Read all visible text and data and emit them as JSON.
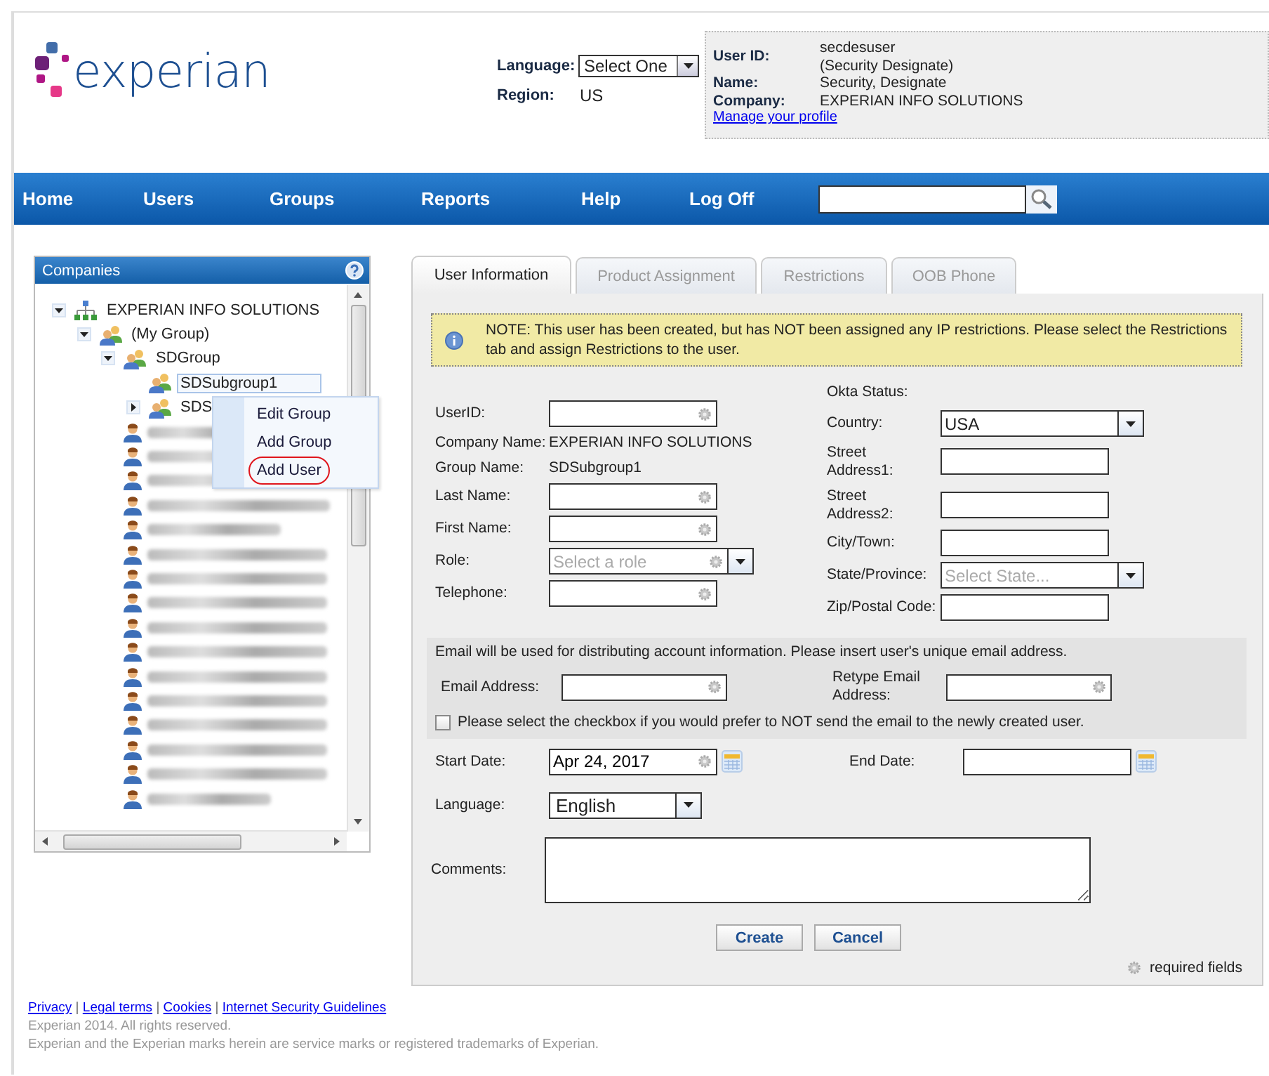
{
  "header": {
    "logo_text": "experian",
    "language": {
      "label": "Language:",
      "value": "Select One"
    },
    "region": {
      "label": "Region:",
      "value": "US"
    },
    "profile": {
      "fields": [
        {
          "label": "User ID:",
          "value": "secdesuser",
          "note": "(Security Designate)"
        },
        {
          "label": "Name:",
          "value": "Security, Designate"
        },
        {
          "label": "Company:",
          "value": "EXPERIAN INFO SOLUTIONS"
        }
      ],
      "link": "Manage your profile"
    }
  },
  "nav": {
    "items": [
      "Home",
      "Users",
      "Groups",
      "Reports",
      "Help",
      "Log Off"
    ]
  },
  "companies_panel": {
    "title": "Companies",
    "tree": [
      {
        "kind": "company",
        "label": "EXPERIAN INFO SOLUTIONS",
        "expanded": true,
        "selected": false,
        "children": [
          {
            "kind": "group",
            "label": "(My Group)",
            "expanded": true,
            "selected": false,
            "children": [
              {
                "kind": "group",
                "label": "SDGroup",
                "expanded": true,
                "selected": false,
                "children": [
                  {
                    "kind": "group",
                    "label": "SDSubgroup1",
                    "selected": true
                  },
                  {
                    "kind": "group",
                    "label": "SDS",
                    "expanded": false,
                    "selected": false
                  }
                ]
              },
              {
                "kind": "user_blurred"
              },
              {
                "kind": "user_blurred"
              },
              {
                "kind": "user_blurred"
              },
              {
                "kind": "user_blurred"
              },
              {
                "kind": "user_blurred"
              },
              {
                "kind": "user_blurred"
              },
              {
                "kind": "user_blurred"
              },
              {
                "kind": "user_blurred"
              },
              {
                "kind": "user_blurred"
              },
              {
                "kind": "user_blurred"
              },
              {
                "kind": "user_blurred"
              },
              {
                "kind": "user_blurred"
              },
              {
                "kind": "user_blurred"
              },
              {
                "kind": "user_blurred"
              },
              {
                "kind": "user_blurred"
              },
              {
                "kind": "user_blurred"
              }
            ]
          }
        ]
      }
    ]
  },
  "context_menu": {
    "items": [
      {
        "label": "Edit Group",
        "circled": false
      },
      {
        "label": "Add Group",
        "circled": false
      },
      {
        "label": "Add User",
        "circled": true
      }
    ]
  },
  "tabs": [
    {
      "label": "User Information",
      "selected": true
    },
    {
      "label": "Product Assignment",
      "selected": false
    },
    {
      "label": "Restrictions",
      "selected": false
    },
    {
      "label": "OOB Phone",
      "selected": false
    }
  ],
  "note": "NOTE: This user has been created, but has NOT been assigned any IP restrictions. Please select the Restrictions tab and assign Restrictions to the user.",
  "left_fields": [
    {
      "kind": "input",
      "label": "UserID:",
      "required": true
    },
    {
      "kind": "text",
      "label": "Company Name:",
      "value": "EXPERIAN INFO SOLUTIONS"
    },
    {
      "kind": "text",
      "label": "Group Name:",
      "value": "SDSubgroup1"
    },
    {
      "kind": "input",
      "label": "Last Name:",
      "required": true
    },
    {
      "kind": "input",
      "label": "First Name:",
      "required": true
    },
    {
      "kind": "select",
      "label": "Role:",
      "placeholder": "Select a role",
      "required": true
    },
    {
      "kind": "input",
      "label": "Telephone:",
      "required": true
    }
  ],
  "right_fields": [
    {
      "kind": "label",
      "label": "Okta Status:"
    },
    {
      "kind": "select",
      "label": "Country:",
      "value": "USA",
      "required": false
    },
    {
      "kind": "input",
      "label": "Street\nAddress1:",
      "required": false
    },
    {
      "kind": "input",
      "label": "Street\nAddress2:",
      "required": false
    },
    {
      "kind": "input",
      "label": "City/Town:",
      "required": false
    },
    {
      "kind": "select",
      "label": "State/Province:",
      "placeholder": "Select State...",
      "required": false
    },
    {
      "kind": "input",
      "label": "Zip/Postal Code:",
      "required": false
    }
  ],
  "email_section": {
    "info": "Email will be used for distributing account information. Please insert user's unique email address.",
    "email": {
      "label": "Email Address:",
      "required": true
    },
    "retype": {
      "label": "Retype Email\nAddress:",
      "required": true
    },
    "opt_out": {
      "label": "Please select the checkbox if you would prefer to NOT send the email to the newly created user.",
      "checked": false
    }
  },
  "start_date": {
    "label": "Start Date:",
    "value": "Apr 24, 2017",
    "required": true
  },
  "end_date": {
    "label": "End Date:",
    "required": false
  },
  "language": {
    "label": "Language:",
    "value": "English"
  },
  "comments": {
    "label": "Comments:"
  },
  "buttons": [
    "Create",
    "Cancel"
  ],
  "legend": "required fields",
  "footer": {
    "separator": "|",
    "links": [
      "Privacy",
      "Legal terms",
      "Cookies",
      "Internet Security Guidelines"
    ],
    "lines": [
      "Experian 2014. All rights reserved.",
      "Experian and the Experian marks herein are service marks or registered trademarks of Experian."
    ]
  }
}
